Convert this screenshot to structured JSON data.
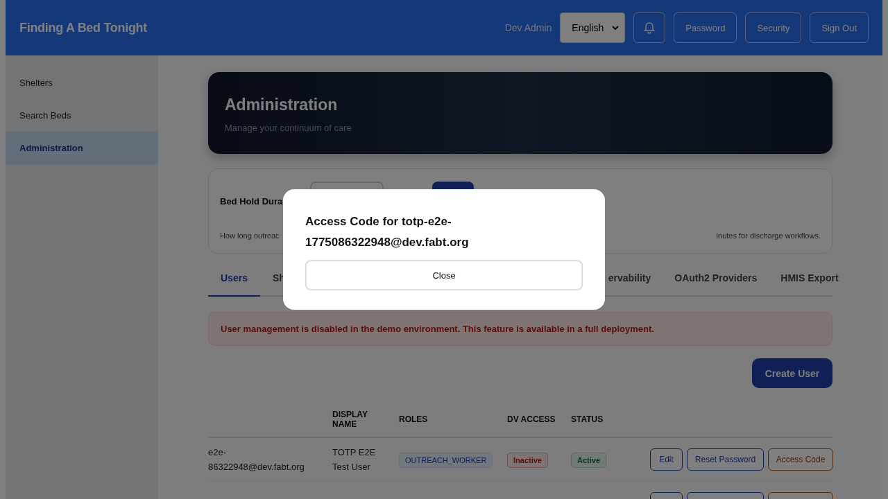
{
  "header": {
    "title": "Finding A Bed Tonight",
    "user": "Dev Admin",
    "language": "English",
    "buttons": [
      "Password",
      "Security",
      "Sign Out"
    ]
  },
  "sidebar": {
    "items": [
      {
        "label": "Shelters",
        "selected": false
      },
      {
        "label": "Search Beds",
        "selected": false
      },
      {
        "label": "Administration",
        "selected": true
      }
    ]
  },
  "banner": {
    "title": "Administration",
    "subtitle": "Manage your continuum of care"
  },
  "settings": {
    "label": "Bed Hold Dura",
    "help_left": "How long outreac",
    "help_right": "inutes for discharge workflows."
  },
  "tabs": [
    {
      "label": "Users",
      "selected": true
    },
    {
      "label": "Sh",
      "selected": false
    },
    {
      "label": "ervability",
      "selected": false
    },
    {
      "label": "OAuth2 Providers",
      "selected": false
    },
    {
      "label": "HMIS Export",
      "selected": false
    }
  ],
  "alert": "User management is disabled in the demo environment. This feature is available in a full deployment.",
  "create_button": "Create User",
  "table": {
    "columns": [
      "DISPLAY NAME",
      "ROLES",
      "DV ACCESS",
      "STATUS"
    ],
    "rows": [
      {
        "email": [
          "e2e-",
          "86322948@dev.fabt.org"
        ],
        "display_name": "TOTP E2E Test User",
        "role": "OUTREACH_WORKER",
        "dv_access": "Inactive",
        "status": "Active",
        "actions": [
          {
            "label": "Edit",
            "kind": "primary"
          },
          {
            "label": "Reset Password",
            "kind": "primary"
          },
          {
            "label": "Access Code",
            "kind": "warning"
          }
        ]
      },
      {
        "actions": [
          {
            "kind": "primary"
          },
          {
            "kind": "primary"
          },
          {
            "kind": "warning"
          }
        ]
      }
    ]
  },
  "modal": {
    "title": "Access Code for totp-e2e-1775086322948@dev.fabt.org",
    "button": "Close"
  }
}
